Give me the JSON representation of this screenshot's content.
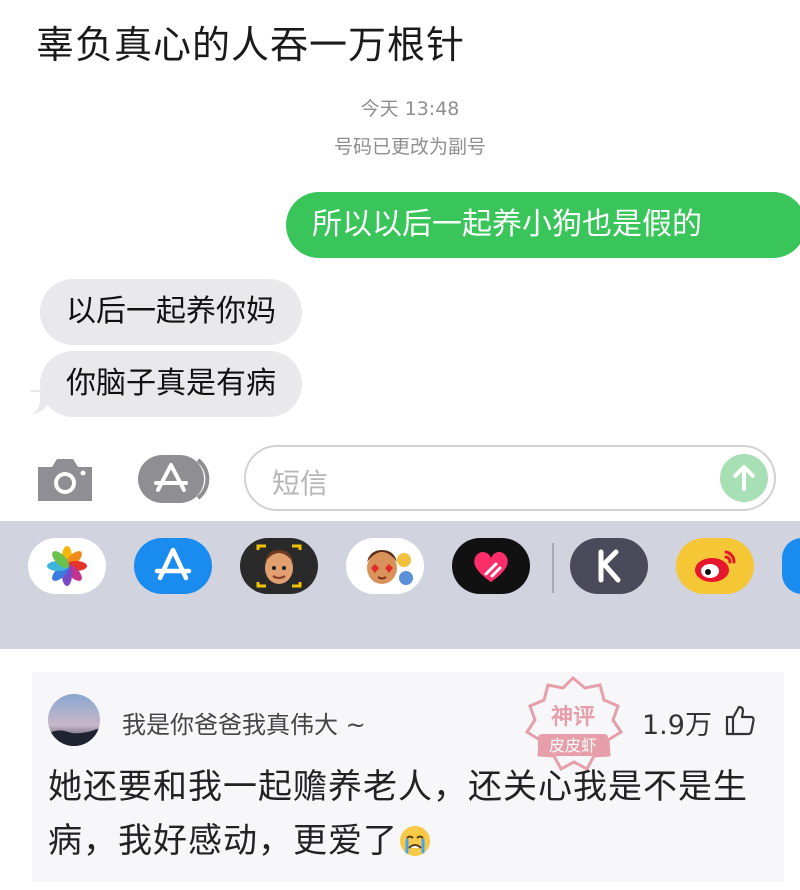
{
  "post": {
    "title": "辜负真心的人吞一万根针"
  },
  "conversation": {
    "timestamp": "今天 13:48",
    "notice": "号码已更改为副号",
    "messages": [
      {
        "direction": "outgoing",
        "text": "所以以后一起养小狗也是假的"
      },
      {
        "direction": "incoming",
        "text": "以后一起养你妈"
      },
      {
        "direction": "incoming",
        "text": "你脑子真是有病"
      }
    ]
  },
  "composer": {
    "placeholder": "短信",
    "camera_icon": "camera-icon",
    "apps_icon": "app-store-icon",
    "send_icon": "arrow-up-icon"
  },
  "app_tray": {
    "apps": [
      "photos-icon",
      "app-store-icon",
      "memoji-icon",
      "animoji-stickers-icon",
      "digital-touch-icon",
      "keep-icon",
      "weibo-icon"
    ]
  },
  "comment": {
    "username": "我是你爸爸我真伟大 ~",
    "like_count": "1.9万",
    "text": "她还要和我一起赡养老人，还关心我是不是生病，我好感动，更爱了",
    "emoji": "crying-face-icon"
  },
  "watermark": {
    "text_top": "神评",
    "text_bottom": "皮皮虾"
  },
  "colors": {
    "outgoing_bubble": "#3ac55b",
    "incoming_bubble": "#e9e9eb",
    "tray_background": "#d1d4df"
  }
}
